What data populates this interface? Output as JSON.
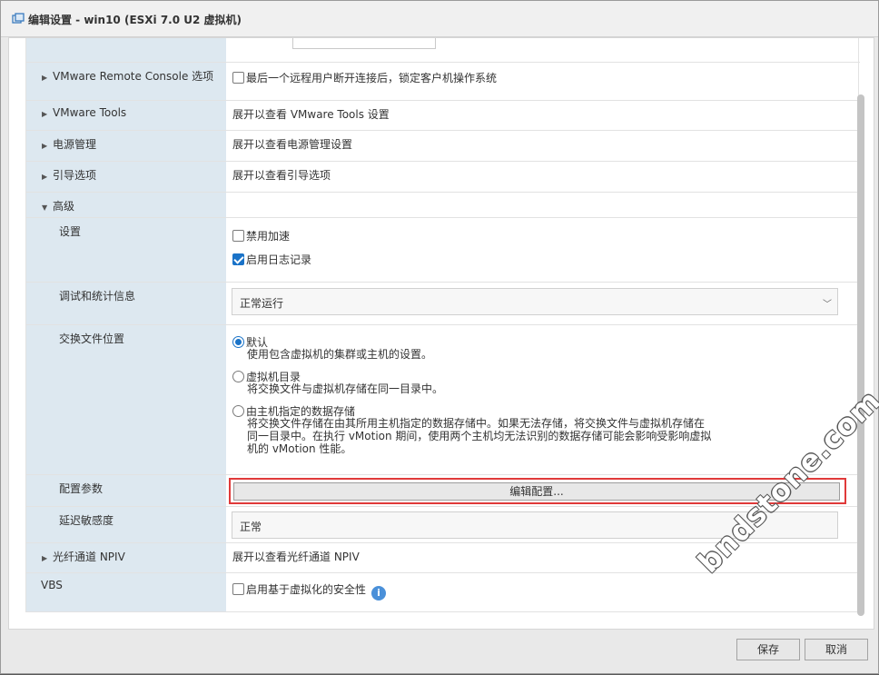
{
  "window": {
    "title": "编辑设置 - win10 (ESXi 7.0 U2 虚拟机)",
    "icon": "vm-settings-icon"
  },
  "rows": {
    "vmrc": {
      "label": "VMware Remote Console 选项",
      "value": "最后一个远程用户断开连接后，锁定客户机操作系统",
      "checked": false
    },
    "tools": {
      "label": "VMware Tools",
      "value": "展开以查看 VMware Tools 设置"
    },
    "power": {
      "label": "电源管理",
      "value": "展开以查看电源管理设置"
    },
    "boot": {
      "label": "引导选项",
      "value": "展开以查看引导选项"
    },
    "advanced": {
      "label": "高级"
    },
    "settings": {
      "label": "设置",
      "disable_accel": {
        "label": "禁用加速",
        "checked": false
      },
      "enable_logging": {
        "label": "启用日志记录",
        "checked": true
      }
    },
    "debug": {
      "label": "调试和统计信息",
      "selected": "正常运行"
    },
    "swap": {
      "label": "交换文件位置",
      "options": [
        {
          "title": "默认",
          "desc": "使用包含虚拟机的集群或主机的设置。",
          "selected": true
        },
        {
          "title": "虚拟机目录",
          "desc": "将交换文件与虚拟机存储在同一目录中。",
          "selected": false
        },
        {
          "title": "由主机指定的数据存储",
          "desc_line1": "将交换文件存储在由其所用主机指定的数据存储中。如果无法存储，将交换文件与虚拟机存储在",
          "desc_line2": "同一目录中。在执行 vMotion 期间，使用两个主机均无法识别的数据存储可能会影响受影响虚拟",
          "desc_line3": "机的 vMotion 性能。",
          "selected": false
        }
      ]
    },
    "config": {
      "label": "配置参数",
      "button": "编辑配置..."
    },
    "latency": {
      "label": "延迟敏感度",
      "value": "正常"
    },
    "npiv": {
      "label": "光纤通道 NPIV",
      "value": "展开以查看光纤通道 NPIV"
    },
    "vbs": {
      "label": "VBS",
      "value": "启用基于虚拟化的安全性",
      "checked": false
    }
  },
  "footer": {
    "save": "保存",
    "cancel": "取消"
  },
  "watermark": "bndstone.com",
  "colors": {
    "accent": "#1a73c8",
    "highlight_border": "#e03a3a",
    "label_bg": "#dde8f0"
  }
}
